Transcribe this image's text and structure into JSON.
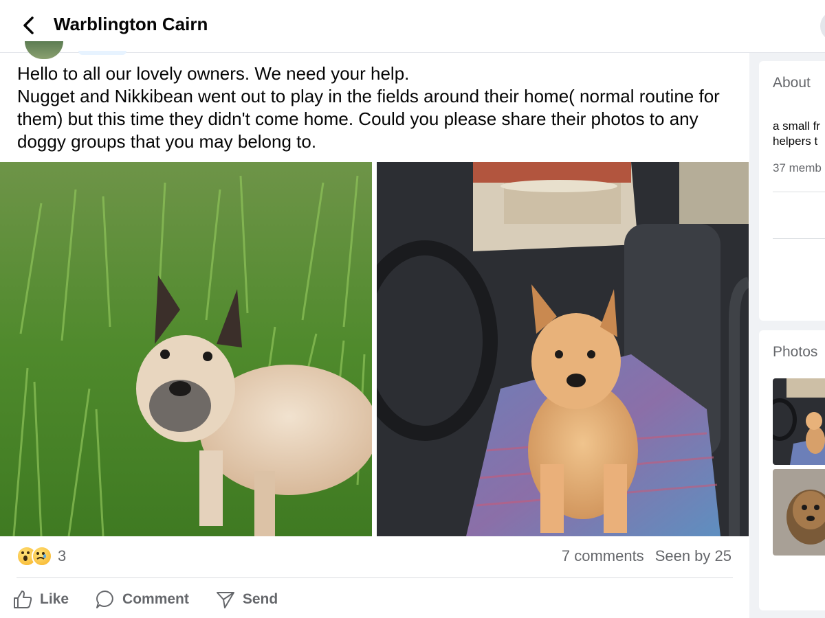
{
  "header": {
    "title": "Warblington Cairn"
  },
  "post": {
    "paragraphs": [
      "Hello to all our lovely owners. We need your help.",
      "Nugget and Nikkibean went out to play in the fields around their home( normal routine for them) but this time they didn't come home. Could you please share their photos to any doggy groups that you may belong to."
    ],
    "photos": [
      {
        "description_icon": "dog-in-grass-photo"
      },
      {
        "description_icon": "dog-in-vehicle-photo"
      }
    ],
    "reaction_count": "3",
    "comments": "7 comments",
    "seen_by": "Seen by 25"
  },
  "actions": {
    "like": "Like",
    "comment": "Comment",
    "send": "Send"
  },
  "sidebar": {
    "about_heading": "About",
    "about_desc_line1": "a small fr",
    "about_desc_line2": "helpers t",
    "members": "37 memb",
    "photos_heading": "Photos"
  },
  "colors": {
    "accent": "#1877f2",
    "muted_text": "#65676b",
    "sidebar_bg": "#f0f2f5"
  }
}
